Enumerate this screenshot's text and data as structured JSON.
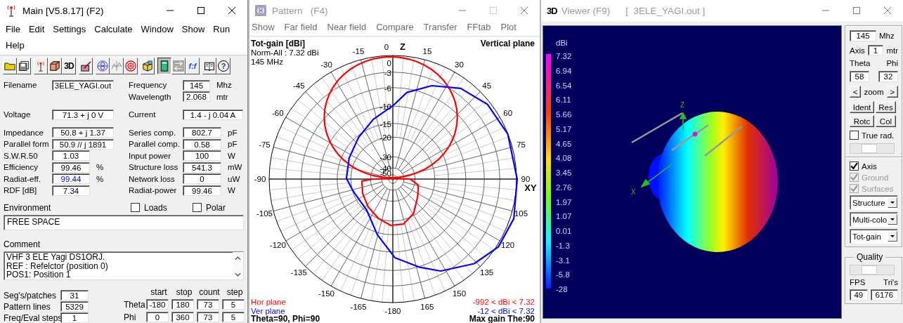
{
  "main_window": {
    "title": "Main [V5.8.17]  (F2)",
    "active": true,
    "menu": [
      "File",
      "Edit",
      "Settings",
      "Calculate",
      "Window",
      "Show",
      "Run",
      "Help"
    ],
    "toolbar": [
      {
        "kind": "folder",
        "pressed": false,
        "disabled": false
      },
      {
        "kind": "disks",
        "pressed": false,
        "disabled": false
      },
      {
        "kind": "antenna",
        "pressed": false,
        "disabled": false
      },
      {
        "kind": "cube",
        "pressed": false,
        "disabled": false
      },
      {
        "kind": "label",
        "label": "3D",
        "pressed": false,
        "disabled": false
      },
      {
        "kind": "pen",
        "pressed": false,
        "disabled": false
      },
      {
        "kind": "globe",
        "pressed": false,
        "disabled": false
      },
      {
        "kind": "wave",
        "pressed": false,
        "disabled": true
      },
      {
        "kind": "target",
        "pressed": false,
        "disabled": false
      },
      {
        "kind": "box",
        "pressed": false,
        "disabled": false
      },
      {
        "kind": "calculator",
        "pressed": true,
        "disabled": false
      },
      {
        "kind": "arrows",
        "pressed": false,
        "disabled": true
      },
      {
        "kind": "formula",
        "label": "f:f",
        "pressed": false,
        "disabled": false
      },
      {
        "kind": "book",
        "pressed": false,
        "disabled": false
      },
      {
        "kind": "help",
        "label": "?",
        "pressed": false,
        "disabled": false
      }
    ],
    "rows": [
      {
        "left": {
          "label": "Filename",
          "value": "3ELE_YAGI.out",
          "highlighted": false
        },
        "right": {
          "label": "Frequency",
          "value": "145",
          "unit": "Mhz"
        }
      },
      {
        "right": {
          "label": "Wavelength",
          "value": "2.068",
          "unit": "mtr"
        }
      },
      {
        "left": {
          "label": "Voltage",
          "value": "71.3 + j 0 V",
          "highlighted": false
        },
        "right": {
          "label": "Current",
          "value": "1.4 - j 0.04 A"
        }
      },
      {
        "left": {
          "label": "Impedance",
          "value": "50.8 + j 1.37",
          "highlighted": false
        },
        "right": {
          "label": "Series comp.",
          "value": "802.7",
          "unit": "pF"
        }
      },
      {
        "left": {
          "label": "Parallel form",
          "value": "50.9 // j 1891",
          "highlighted": false
        },
        "right": {
          "label": "Parallel comp.",
          "value": "0.58",
          "unit": "pF"
        }
      },
      {
        "left": {
          "label": "S.W.R.50",
          "value": "1.03",
          "highlighted": false
        },
        "right": {
          "label": "Input power",
          "value": "100",
          "unit": "W"
        }
      },
      {
        "left": {
          "label": "Efficiency",
          "value": "99.46",
          "unit": "%",
          "highlighted": false
        },
        "right": {
          "label": "Structure loss",
          "value": "541.3",
          "unit": "mW"
        }
      },
      {
        "left": {
          "label": "Radiat-eff.",
          "value": "99.44",
          "unit": "%",
          "highlighted": true
        },
        "right": {
          "label": "Network loss",
          "value": "0",
          "unit": "uW"
        }
      },
      {
        "left": {
          "label": "RDF [dB]",
          "value": "7.34",
          "highlighted": false
        },
        "right": {
          "label": "Radiat-power",
          "value": "99.46",
          "unit": "W"
        }
      }
    ],
    "environment": {
      "label": "Environment",
      "value": "FREE SPACE"
    },
    "checkboxes": [
      {
        "label": "Loads",
        "checked": false
      },
      {
        "label": "Polar",
        "checked": false
      }
    ],
    "comment": {
      "label": "Comment",
      "lines": [
        "VHF 3 ELE Yagi DS1ORJ.",
        "REF : Refelctor (position 0)",
        "POS1: Position 1"
      ]
    },
    "counts": [
      {
        "label": "Seg's/patches",
        "value": "31"
      },
      {
        "label": "Pattern lines",
        "value": "5329"
      },
      {
        "label": "Freq/Eval steps",
        "value": "1"
      }
    ],
    "range_table": {
      "columns": [
        "start",
        "stop",
        "count",
        "step"
      ],
      "rows": [
        {
          "label": "Theta",
          "values": [
            "-180",
            "180",
            "73",
            "5"
          ]
        },
        {
          "label": "Phi",
          "values": [
            "0",
            "360",
            "73",
            "5"
          ]
        }
      ]
    }
  },
  "pattern_window": {
    "title": "Pattern   (F4)",
    "active": false,
    "menu": [
      "Show",
      "Far field",
      "Near field",
      "Compare",
      "Transfer",
      "FFtab",
      "Plot"
    ],
    "plot": {
      "quantity": "Tot-gain [dBi]",
      "norm": "Norm-All : 7.32 dBi",
      "frequency": "145 MHz",
      "plane": "Vertical plane",
      "z_label": "Z",
      "xy_label": "XY",
      "angle_labels": [
        "0",
        "-15",
        "15",
        "-30",
        "30",
        "-45",
        "45",
        "-60",
        "60",
        "-75",
        "75",
        "-90",
        "90",
        "-105",
        "105",
        "-120",
        "120",
        "-135",
        "135",
        "-150",
        "150",
        "-165",
        "165",
        "-180"
      ],
      "ring_labels": [
        "0",
        "-3",
        "-6",
        "-10",
        "-15",
        "-20",
        "-30",
        "-40",
        "-50"
      ],
      "series": [
        {
          "name": "Hor plane",
          "range": "-992 < dBi < 7.32",
          "color": "#ff0000"
        },
        {
          "name": "Ver plane",
          "range": "-12 < dBi < 7.32",
          "color": "#0000ff"
        }
      ],
      "position": "Theta=90, Phi=90",
      "max_gain": "Max gain The:90"
    }
  },
  "viewer_window": {
    "icon_label": "3D",
    "title": "Viewer (F9)",
    "file": "[  3ELE_YAGI.out ]",
    "active": false,
    "legend": {
      "title": "dBi",
      "values": [
        "7.32",
        "6.94",
        "6.54",
        "6.11",
        "5.66",
        "5.17",
        "4.65",
        "4.08",
        "3.45",
        "2.76",
        "1.97",
        "1.07",
        "0.01",
        "-1.3",
        "-3.1",
        "-5.8",
        "-28"
      ]
    },
    "axis_labels": [
      "Z",
      "X"
    ],
    "controls": {
      "frequency": "145",
      "frequency_unit": "Mhz",
      "axis_label": "Axis",
      "axis_value": "1",
      "axis_unit": "mtr",
      "theta_label": "Theta",
      "phi_label": "Phi",
      "theta": "58",
      "phi": "32",
      "zoom_prev": "<",
      "zoom_label": "zoom",
      "zoom_next": ">",
      "buttons": [
        "Ident",
        "Res",
        "Rotc",
        "Col"
      ],
      "true_rad": {
        "label": "True rad.",
        "checked": false
      }
    },
    "options": [
      {
        "label": "Axis",
        "checked": true,
        "disabled": false
      },
      {
        "label": "Ground",
        "checked": true,
        "disabled": true
      },
      {
        "label": "Surfaces",
        "checked": true,
        "disabled": true
      }
    ],
    "dropdowns": [
      "Structure",
      "Multi-colo",
      "Tot-gain"
    ],
    "quality": {
      "title": "Quality",
      "fps_label": "FPS",
      "tris_label": "Tri's",
      "fps": "49",
      "tris": "6176"
    }
  }
}
